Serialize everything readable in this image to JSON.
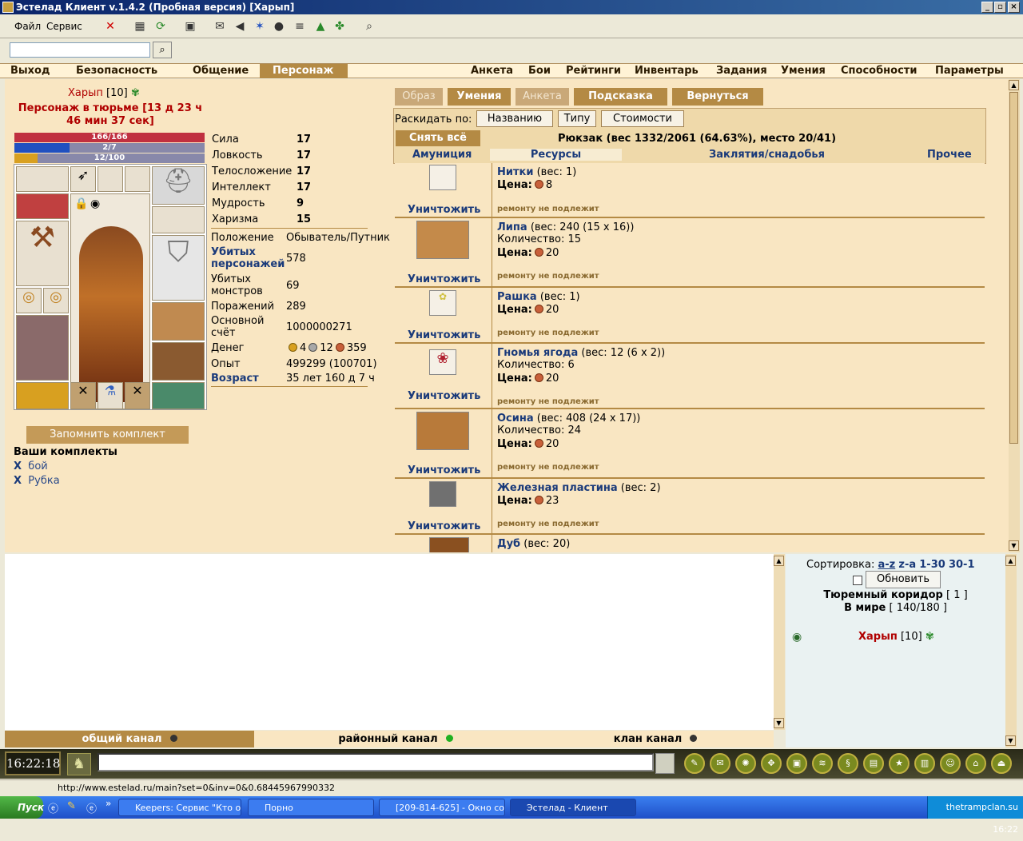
{
  "window": {
    "title": "Эстелад Клиент v.1.4.2 (Пробная версия) [Харып]"
  },
  "menu": {
    "file": "Файл",
    "service": "Сервис"
  },
  "nav": {
    "left": [
      "Выход",
      "Безопасность",
      "Общение",
      "Персонаж"
    ],
    "right": [
      "Анкета",
      "Бои",
      "Рейтинги",
      "Инвентарь",
      "Задания",
      "Умения",
      "Способности",
      "Параметры"
    ]
  },
  "character": {
    "name": "Харып",
    "level": "[10]",
    "jail": "Персонаж в тюрьме [13 д 23 ч",
    "jail2": "46 мин 37 сек]",
    "hp": "166/166",
    "mp": "2/7",
    "exp_bar": "12/100",
    "exp_fill": 0.12,
    "mp_fill": 0.29
  },
  "stats": [
    {
      "label": "Сила",
      "value": "17"
    },
    {
      "label": "Ловкость",
      "value": "17"
    },
    {
      "label": "Телосложение",
      "value": "17"
    },
    {
      "label": "Интеллект",
      "value": "17"
    },
    {
      "label": "Мудрость",
      "value": "9"
    },
    {
      "label": "Харизма",
      "value": "15"
    }
  ],
  "info": {
    "position_label": "Положение",
    "position_value": "Обыватель/Путник",
    "kills_label": "Убитых персонажей",
    "kills_value": "578",
    "monsters_label": "Убитых монстров",
    "monsters_value": "69",
    "defeats_label": "Поражений",
    "defeats_value": "289",
    "account_label": "Основной счёт",
    "account_value": "1000000271",
    "money_label": "Денег",
    "money_gold": "4",
    "money_silver": "12",
    "money_copper": "359",
    "exp_label": "Опыт",
    "exp_value": "499299 (100701)",
    "age_label": "Возраст",
    "age_value": "35 лет 160 д 7 ч"
  },
  "sets": {
    "remember_btn": "Запомнить комплект",
    "title": "Ваши комплекты",
    "x": "X",
    "items": [
      "бой",
      "Рубка"
    ]
  },
  "tabs": [
    "Образ",
    "Умения",
    "Анкета",
    "Подсказка",
    "Вернуться"
  ],
  "sorting": {
    "label": "Раскидать по:",
    "by_name": "Названию",
    "by_type": "Типу",
    "by_cost": "Стоимости"
  },
  "backpack": {
    "unequip_all": "Снять всё",
    "summary": "Рюкзак (вес 1332/2061 (64.63%), место 20/41)",
    "categories": [
      "Амуниция",
      "Ресурсы",
      "Заклятия/снадобья",
      "Прочее"
    ],
    "destroy": "Уничтожить",
    "repair": "ремонту не подлежит",
    "qty_label": "Количество:",
    "price_label": "Цена:",
    "items": [
      {
        "name": "Нитки",
        "weight": "(вес: 1)",
        "qty": "",
        "price": "8"
      },
      {
        "name": "Липа",
        "weight": "(вес: 240 (15 x 16))",
        "qty": "15",
        "price": "20"
      },
      {
        "name": "Рашка",
        "weight": "(вес: 1)",
        "qty": "",
        "price": "20"
      },
      {
        "name": "Гномья ягода",
        "weight": "(вес: 12 (6 x 2))",
        "qty": "6",
        "price": "20"
      },
      {
        "name": "Осина",
        "weight": "(вес: 408 (24 x 17))",
        "qty": "24",
        "price": "20"
      },
      {
        "name": "Железная пластина",
        "weight": "(вес: 2)",
        "qty": "",
        "price": "23"
      },
      {
        "name": "Дуб",
        "weight": "(вес: 20)",
        "qty": "",
        "price": ""
      }
    ]
  },
  "userpanel": {
    "sort_label": "Сортировка:",
    "sort_az": "a-z",
    "sort_za": "z-a",
    "sort_130": "1-30",
    "sort_301": "30-1",
    "refresh": "Обновить",
    "location": "Тюремный коридор",
    "location_count": "[ 1 ]",
    "world": "В мире",
    "world_count": "[ 140/180 ]",
    "user_name": "Харып",
    "user_level": "[10]"
  },
  "channels": [
    "общий канал",
    "районный канал",
    "клан канал"
  ],
  "bottom": {
    "clock": "16:22:18"
  },
  "status": {
    "url": "http://www.estelad.ru/main?set=0&inv=0&0.68445967990332"
  },
  "taskbar": {
    "start": "Пуск",
    "tasks": [
      "Keepers: Сервис \"Кто о...",
      "Порно",
      "[209-814-625] - Окно со...",
      "Эстелад - Клиент"
    ],
    "time": "16:22",
    "tray_text": "thetrampclan.su"
  },
  "colors": {
    "accent": "#b48a44",
    "link": "#1a3a7a",
    "jail": "#b00000",
    "panel": "#f9e6c2"
  }
}
